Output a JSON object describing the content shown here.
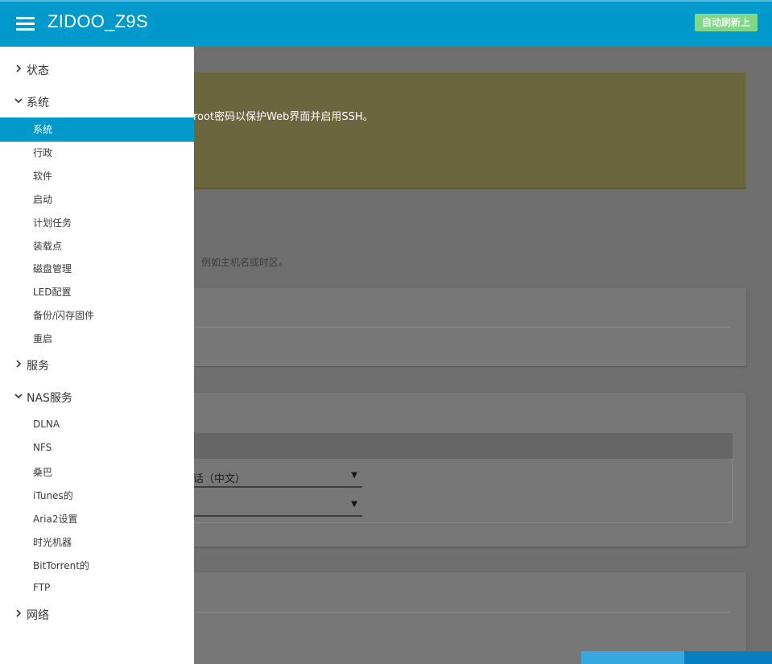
{
  "header": {
    "title": "ZIDOO_Z9S",
    "refresh_label": "自动刷新上",
    "bg_color": "#0099cc"
  },
  "main": {
    "alert_text": "root密码以保护Web界面并启用SSH。",
    "description": "例如主机名或时区。",
    "language_value": "话（中文）",
    "theme_value": ""
  },
  "sidebar": {
    "categories": [
      {
        "label": "状态",
        "expanded": false
      },
      {
        "label": "系统",
        "expanded": true
      },
      {
        "label": "服务",
        "expanded": false
      },
      {
        "label": "NAS服务",
        "expanded": true
      },
      {
        "label": "网络",
        "expanded": false
      }
    ],
    "system_items": [
      "系统",
      "行政",
      "软件",
      "启动",
      "计划任务",
      "装载点",
      "磁盘管理",
      "LED配置",
      "备份/闪存固件",
      "重启"
    ],
    "nas_items": [
      "DLNA",
      "NFS",
      "桑巴",
      "iTunes的",
      "Aria2设置",
      "时光机器",
      "BitTorrent的",
      "FTP"
    ],
    "active_item": "系统",
    "accent_color": "#0099cc"
  }
}
